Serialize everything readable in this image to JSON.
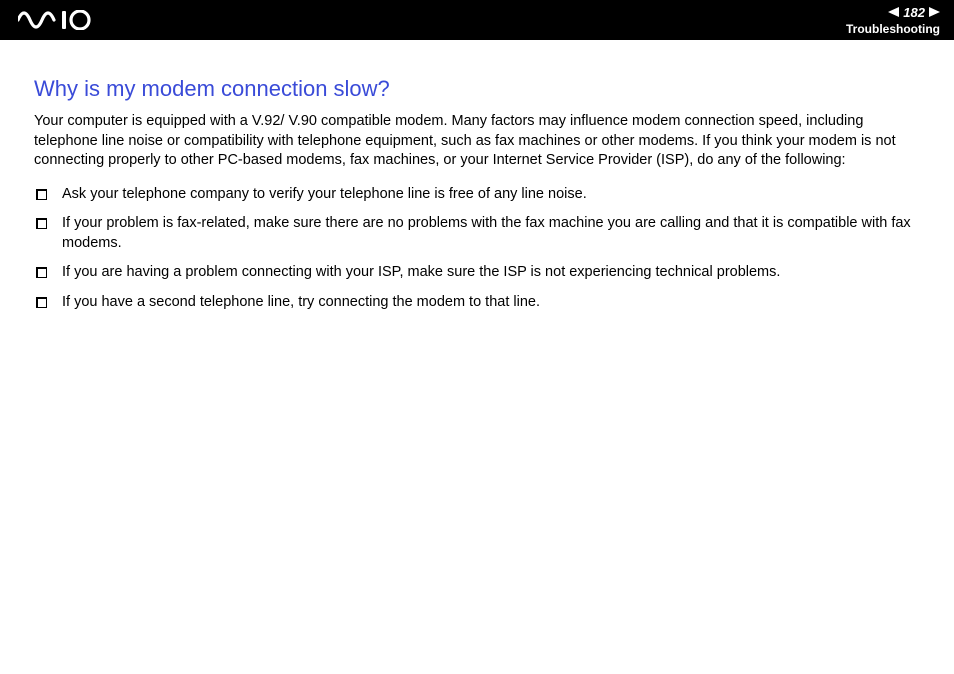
{
  "header": {
    "page_number": "182",
    "section": "Troubleshooting"
  },
  "content": {
    "heading": "Why is my modem connection slow?",
    "intro": "Your computer is equipped with a V.92/ V.90 compatible modem. Many factors may influence modem connection speed, including telephone line noise or compatibility with telephone equipment, such as fax machines or other modems. If you think your modem is not connecting properly to other PC-based modems, fax machines, or your Internet Service Provider (ISP), do any of the following:",
    "bullets": [
      "Ask your telephone company to verify your telephone line is free of any line noise.",
      "If your problem is fax-related, make sure there are no problems with the fax machine you are calling and that it is compatible with fax modems.",
      "If you are having a problem connecting with your ISP, make sure the ISP is not experiencing technical problems.",
      "If you have a second telephone line, try connecting the modem to that line."
    ]
  }
}
